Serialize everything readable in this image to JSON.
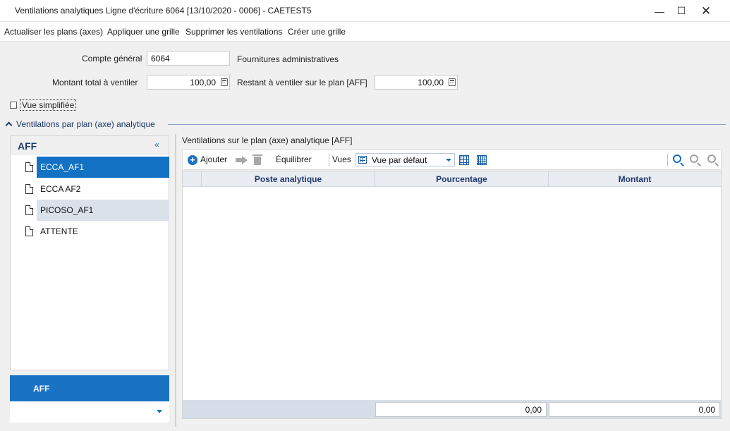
{
  "window": {
    "title": "Ventilations analytiques Ligne d'écriture 6064 [13/10/2020 - 0006] - CAETEST5",
    "minimize": "—",
    "maximize": "☐",
    "close": "✕"
  },
  "menu": {
    "items": [
      "Actualiser les plans (axes)",
      "Appliquer une grille",
      "Supprimer les ventilations",
      "Créer une grille"
    ]
  },
  "form": {
    "compte_label": "Compte général",
    "compte_value": "6064",
    "compte_desc": "Fournitures administratives",
    "montant_label": "Montant total à ventiler",
    "montant_value": "100,00",
    "restant_label": "Restant à ventiler sur le plan [AFF]",
    "restant_value": "100,00",
    "vue_simplifiee": "Vue simplifiée"
  },
  "section": {
    "title": "Ventilations par plan (axe) analytique"
  },
  "left_panel": {
    "title": "AFF",
    "collapse": "«",
    "items": [
      "ECCA_AF1",
      "ECCA AF2",
      "PICOSO_AF1",
      "ATTENTE"
    ],
    "tab_label": "AFF"
  },
  "right_panel": {
    "title": "Ventilations sur le plan (axe) analytique [AFF]",
    "toolbar": {
      "add_icon": "+",
      "add": "Ajouter",
      "equilibrer": "Équilibrer",
      "vues_label": "Vues",
      "vue_value": "Vue par défaut"
    },
    "columns": [
      "Poste analytique",
      "Pourcentage",
      "Montant"
    ],
    "totals": {
      "pourcentage": "0,00",
      "montant": "0,00"
    }
  }
}
